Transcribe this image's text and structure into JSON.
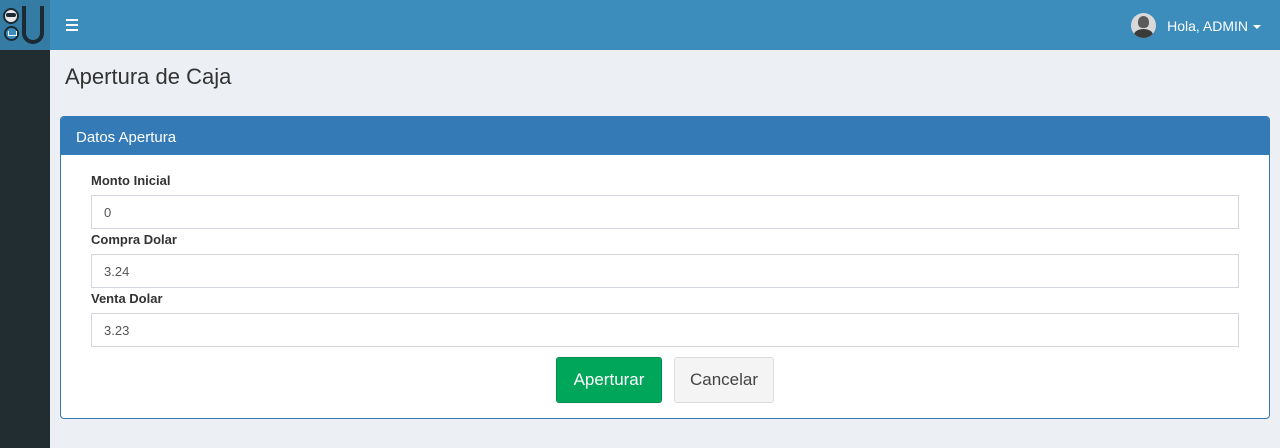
{
  "header": {
    "user_greeting": "Hola, ADMIN"
  },
  "page": {
    "title": "Apertura de Caja"
  },
  "panel": {
    "title": "Datos Apertura",
    "fields": [
      {
        "label": "Monto Inicial",
        "value": "0"
      },
      {
        "label": "Compra Dolar",
        "value": "3.24"
      },
      {
        "label": "Venta Dolar",
        "value": "3.23"
      }
    ],
    "buttons": {
      "submit_label": "Aperturar",
      "cancel_label": "Cancelar"
    }
  },
  "icons": {
    "menu": "hamburger-menu-icon",
    "logo": "app-logo",
    "user_avatar": "user-avatar",
    "dropdown": "caret-down-icon"
  },
  "colors": {
    "header": "#3c8dbc",
    "sidebar": "#222d32",
    "panel_primary": "#337ab7",
    "success": "#00a65a",
    "background": "#ecf0f5"
  }
}
